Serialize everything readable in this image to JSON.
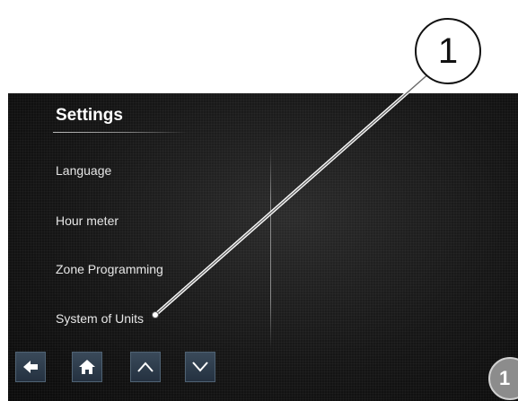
{
  "screen": {
    "title": "Settings",
    "menu": [
      {
        "label": "Language"
      },
      {
        "label": "Hour meter"
      },
      {
        "label": "Zone Programming"
      },
      {
        "label": "System of Units"
      }
    ],
    "toolbar": {
      "buttons": [
        {
          "icon": "arrow-left-icon"
        },
        {
          "icon": "home-icon"
        },
        {
          "icon": "chevron-up-icon"
        },
        {
          "icon": "chevron-down-icon"
        }
      ]
    }
  },
  "callout": {
    "number": "1"
  },
  "badge": {
    "number": "1"
  },
  "colors": {
    "screen_bg": "#111111",
    "button_bg": "#2f3d4c",
    "text": "#e6e6e6"
  }
}
